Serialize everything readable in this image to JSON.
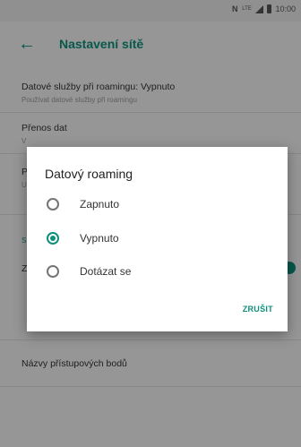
{
  "status_bar": {
    "nfc": "N",
    "network": "LTE",
    "time": "10:00"
  },
  "app_bar": {
    "title": "Nastavení sítě"
  },
  "settings": [
    {
      "title": "Datové služby při roamingu: Vypnuto",
      "subtitle": "Používat datové služby při roamingu"
    },
    {
      "title": "Přenos dat",
      "subtitle": "V"
    },
    {
      "title": "P",
      "subtitle": "U"
    },
    {
      "title": "S",
      "subtitle": ""
    },
    {
      "title": "Z",
      "subtitle": ""
    },
    {
      "title": "Názvy přístupových bodů",
      "subtitle": ""
    }
  ],
  "dialog": {
    "title": "Datový roaming",
    "options": [
      {
        "label": "Zapnuto",
        "checked": false
      },
      {
        "label": "Vypnuto",
        "checked": true
      },
      {
        "label": "Dotázat se",
        "checked": false
      }
    ],
    "cancel_label": "ZRUŠIT"
  },
  "colors": {
    "accent": "#0d8f7c",
    "scrim": "rgba(0,0,0,0.38)"
  }
}
